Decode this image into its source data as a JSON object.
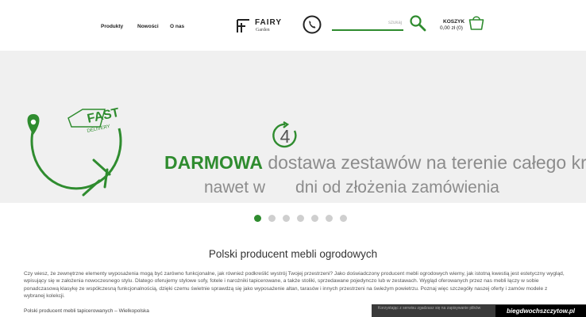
{
  "nav": {
    "items": [
      {
        "label": "Produkty"
      },
      {
        "label": "Nowości"
      },
      {
        "label": "O nas"
      }
    ]
  },
  "logo": {
    "title": "FAIRY",
    "subtitle": "Garden"
  },
  "search": {
    "placeholder": "szukaj"
  },
  "cart": {
    "label": "KOSZYK",
    "value": "0,00 zł (0)"
  },
  "banner": {
    "highlight": "DARMOWA",
    "line1_rest": "dostawa zestawów na terenie całego kraju",
    "line2_before": "nawet w",
    "number": "4",
    "line2_after": "dni od złożenia zamówienia",
    "badge_fast": "FAST",
    "badge_delivery": "DELIVERY"
  },
  "slider": {
    "dot_count": 7,
    "active_index": 0
  },
  "section": {
    "title": "Polski producent mebli ogrodowych",
    "description": "Czy wiesz, że zewnętrzne elementy wyposażenia mogą być zarówno funkcjonalne, jak również podkreślić wystrój Twojej przestrzeni? Jako doświadczony producent mebli ogrodowych wiemy, jak istotną kwestią jest estetyczny wygląd, wpisujący się w założenia nowoczesnego stylu. Dlatego oferujemy stylowe sofy, fotele i narożniki tapicerowane, a także stoliki, sprzedawane pojedynczo lub w zestawach. Wygląd oferowanych przez nas mebli łączy w sobie ponadczasową klasykę ze współczesną funkcjonalnością, dzięki czemu świetnie sprawdzą się jako wyposażenie altan, tarasów i innych przestrzeni na świeżym powietrzu. Poznaj więc szczegóły naszej oferty i zamów modele z wybranej kolekcji.",
    "subtext": "Polski producent mebli tapicerowanych – Wielkopolska"
  },
  "cookie": {
    "text": "Korzystając z serwisu zgadzasz się na zapisywanie plików"
  },
  "watermark": {
    "text": "biegdwochszczytow.pl"
  },
  "colors": {
    "accent": "#2f8c2f",
    "banner_bg": "#f0f0f0",
    "text_gray": "#8c8c8c"
  }
}
